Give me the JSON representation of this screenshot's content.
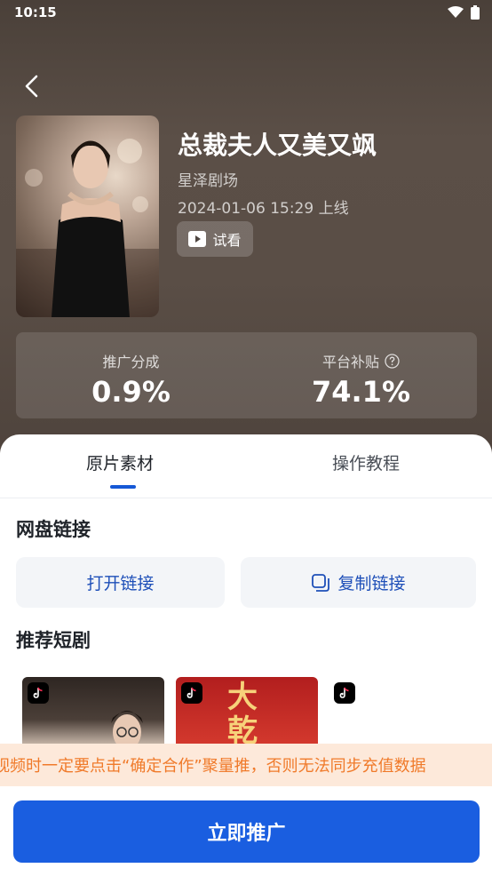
{
  "status_bar": {
    "time": "10:15"
  },
  "drama": {
    "title": "总裁夫人又美又飒",
    "studio": "星泽剧场",
    "release": "2024-01-06 15:29 上线",
    "preview_label": "试看"
  },
  "stats": {
    "promo_share_label": "推广分成",
    "promo_share_value": "0.9%",
    "subsidy_label": "平台补贴",
    "subsidy_value": "74.1%"
  },
  "tabs": [
    {
      "label": "原片素材",
      "active": true
    },
    {
      "label": "操作教程",
      "active": false
    }
  ],
  "netdisk": {
    "title": "网盘链接",
    "open_label": "打开链接",
    "copy_label": "复制链接"
  },
  "recommend": {
    "title": "推荐短剧",
    "cards": [
      {
        "overlay_text": ""
      },
      {
        "overlay_text": "大乾"
      },
      {
        "overlay_text": ""
      }
    ]
  },
  "notice": "视频时一定要点击“确定合作”聚量推，否则无法同步充值数据",
  "cta_label": "立即推广",
  "colors": {
    "accent": "#1a5ee0",
    "notice_bg": "#fde9da",
    "notice_text": "#f07a2a",
    "link_text": "#1e4fb8"
  }
}
